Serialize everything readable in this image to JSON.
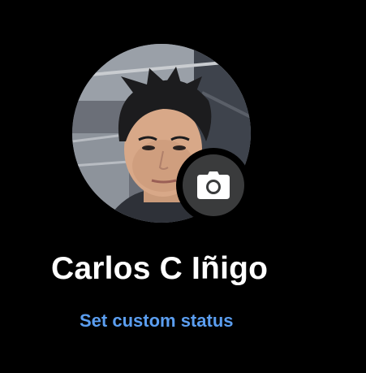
{
  "profile": {
    "name": "Carlos C Iñigo",
    "avatar_description_icon": "user-photo",
    "camera_icon": "camera-icon"
  },
  "actions": {
    "set_status_label": "Set custom status"
  },
  "colors": {
    "background": "#000000",
    "name_text": "#ffffff",
    "link_accent": "#5b9ef0",
    "camera_badge": "#3a3b3c"
  }
}
